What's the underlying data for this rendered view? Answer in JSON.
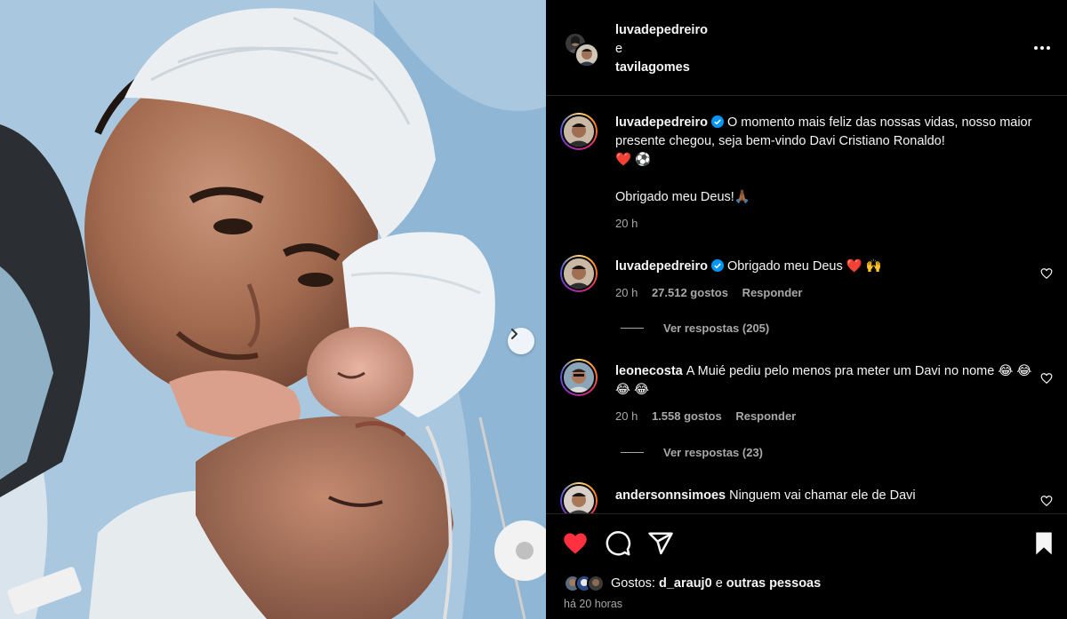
{
  "header": {
    "user1": "luvadepedreiro",
    "connector": "e",
    "user2": "tavilagomes"
  },
  "caption": {
    "username": "luvadepedreiro",
    "text": "O momento mais feliz das nossas vidas, nosso maior presente chegou, seja bem-vindo Davi Cristiano Ronaldo!",
    "emojis": "❤️ ⚽",
    "line2": "Obrigado meu Deus!🙏🏾",
    "time": "20 h"
  },
  "comments": [
    {
      "username": "luvadepedreiro",
      "text": "Obrigado meu Deus ❤️ 🙌",
      "time": "20 h",
      "likes": "27.512 gostos",
      "reply": "Responder",
      "view_replies": "Ver respostas (205)"
    },
    {
      "username": "leonecosta",
      "text": "A Muié pediu pelo menos pra meter um Davi no nome 😂 😂 😂 😂",
      "time": "20 h",
      "likes": "1.558 gostos",
      "reply": "Responder",
      "view_replies": "Ver respostas (23)"
    },
    {
      "username": "andersonnsimoes",
      "text": "Ninguem vai chamar ele de Davi"
    }
  ],
  "actions": {
    "likes_label": "Gostos:",
    "likes_user": "d_arauj0",
    "likes_connector": "e",
    "likes_others": "outras pessoas",
    "time_ago": "há 20 horas"
  },
  "icons": {
    "like": "heart-filled-icon",
    "comment": "comment-icon",
    "share": "send-icon",
    "save": "bookmark-filled-icon",
    "more": "more-horizontal-icon",
    "next": "chevron-right-icon"
  },
  "colors": {
    "background": "#000000",
    "text": "#f5f5f5",
    "muted": "#a8a8a8",
    "like_red": "#ff3040",
    "verified_blue": "#0095f6"
  }
}
